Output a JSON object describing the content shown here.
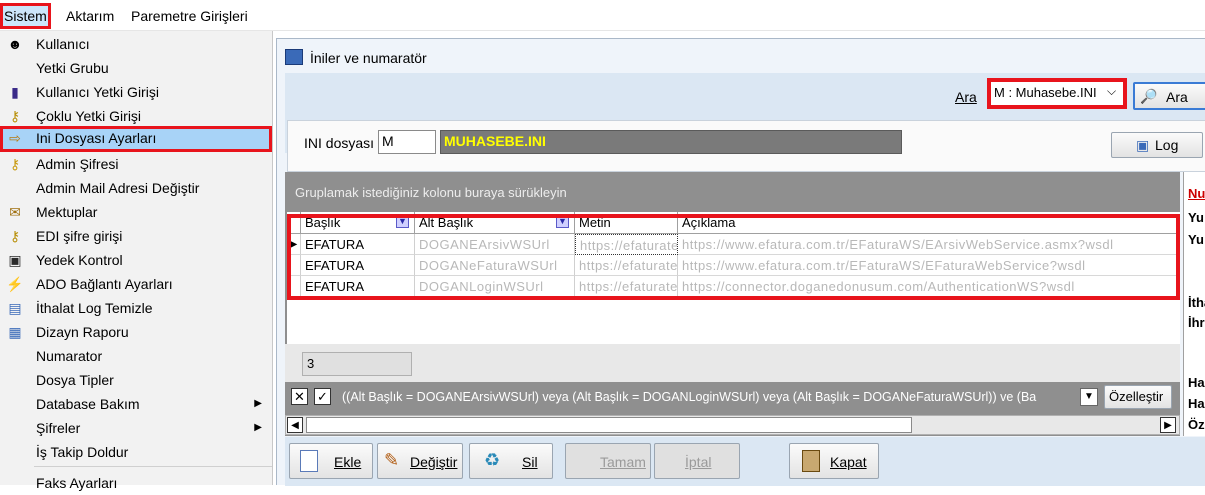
{
  "menubar": {
    "items": [
      "Sistem",
      "Aktarım",
      "Paremetre Girişleri"
    ]
  },
  "menu": {
    "items": [
      {
        "label": "Kullanıcı",
        "icon": "user-icon"
      },
      {
        "label": "Yetki Grubu",
        "icon": ""
      },
      {
        "label": "Kullanıcı Yetki Girişi",
        "icon": "user-key-icon"
      },
      {
        "label": "Çoklu Yetki Girişi",
        "icon": "keys-icon"
      },
      {
        "label": "Ini Dosyası  Ayarları",
        "icon": "file-arrow-icon"
      },
      {
        "label": "Admin Şifresi",
        "icon": "key-icon"
      },
      {
        "label": "Admin Mail Adresi Değiştir",
        "icon": ""
      },
      {
        "label": "Mektuplar",
        "icon": "envelope-icon"
      },
      {
        "label": "EDI şifre girişi",
        "icon": "keys-icon"
      },
      {
        "label": "Yedek Kontrol",
        "icon": "backup-icon"
      },
      {
        "label": "ADO Bağlantı Ayarları",
        "icon": "connection-icon"
      },
      {
        "label": "İthalat Log Temizle",
        "icon": "log-icon"
      },
      {
        "label": "Dizayn Raporu",
        "icon": "report-icon"
      },
      {
        "label": "Numarator",
        "icon": ""
      },
      {
        "label": "Dosya Tipler",
        "icon": ""
      },
      {
        "label": "Database Bakım",
        "icon": "",
        "submenu": "▶"
      },
      {
        "label": "Şifreler",
        "icon": "",
        "submenu": "▶"
      },
      {
        "label": "İş Takip Doldur",
        "icon": ""
      },
      {
        "label": "Faks Ayarları",
        "icon": ""
      }
    ]
  },
  "window": {
    "title": "İniler ve numaratör"
  },
  "search": {
    "label": "Ara",
    "selected": "M : Muhasebe.INI",
    "button": "Ara"
  },
  "ini": {
    "label": "INI dosyası",
    "code": "M",
    "name": "MUHASEBE.INI",
    "log_button": "Log"
  },
  "grid": {
    "group_hint": "Gruplamak istediğiniz kolonu buraya sürükleyin",
    "columns": [
      "Başlık",
      "Alt Başlık",
      "Metin",
      "Açıklama"
    ],
    "rows": [
      {
        "baslik": "EFATURA",
        "alt": "DOGANEArsivWSUrl",
        "metin": "https://efaturatest",
        "aciklama": "https://www.efatura.com.tr/EFaturaWS/EArsivWebService.asmx?wsdl"
      },
      {
        "baslik": "EFATURA",
        "alt": "DOGANeFaturaWSUrl",
        "metin": "https://efaturatest",
        "aciklama": "https://www.efatura.com.tr/EFaturaWS/EFaturaWebService?wsdl"
      },
      {
        "baslik": "EFATURA",
        "alt": "DOGANLoginWSUrl",
        "metin": "https://efaturatest",
        "aciklama": "https://connector.doganedonusum.com/AuthenticationWS?wsdl"
      }
    ],
    "row_count": "3"
  },
  "filter": {
    "text": "((Alt Başlık = DOGANEArsivWSUrl) veya (Alt Başlık = DOGANLoginWSUrl) veya (Alt Başlık = DOGANeFaturaWSUrl)) ve (Ba",
    "customize_button": "Özelleştir"
  },
  "right_panel": {
    "items": [
      "Nu",
      "Yu",
      "Yu",
      "İtha",
      "İhra",
      "Ha",
      "Ha",
      "Öz"
    ]
  },
  "buttons": {
    "add": "Ekle",
    "edit": "Değiştir",
    "delete": "Sil",
    "ok": "Tamam",
    "cancel": "İptal",
    "close": "Kapat"
  },
  "colors": {
    "highlight_red": "#e8141c",
    "menu_selected": "#a8d3f7",
    "ini_name_bg": "#7a7a7a",
    "ini_name_fg": "#ffff00",
    "grid_group_bg": "#8f8f8f",
    "right_panel_accent": "#cc0000"
  }
}
